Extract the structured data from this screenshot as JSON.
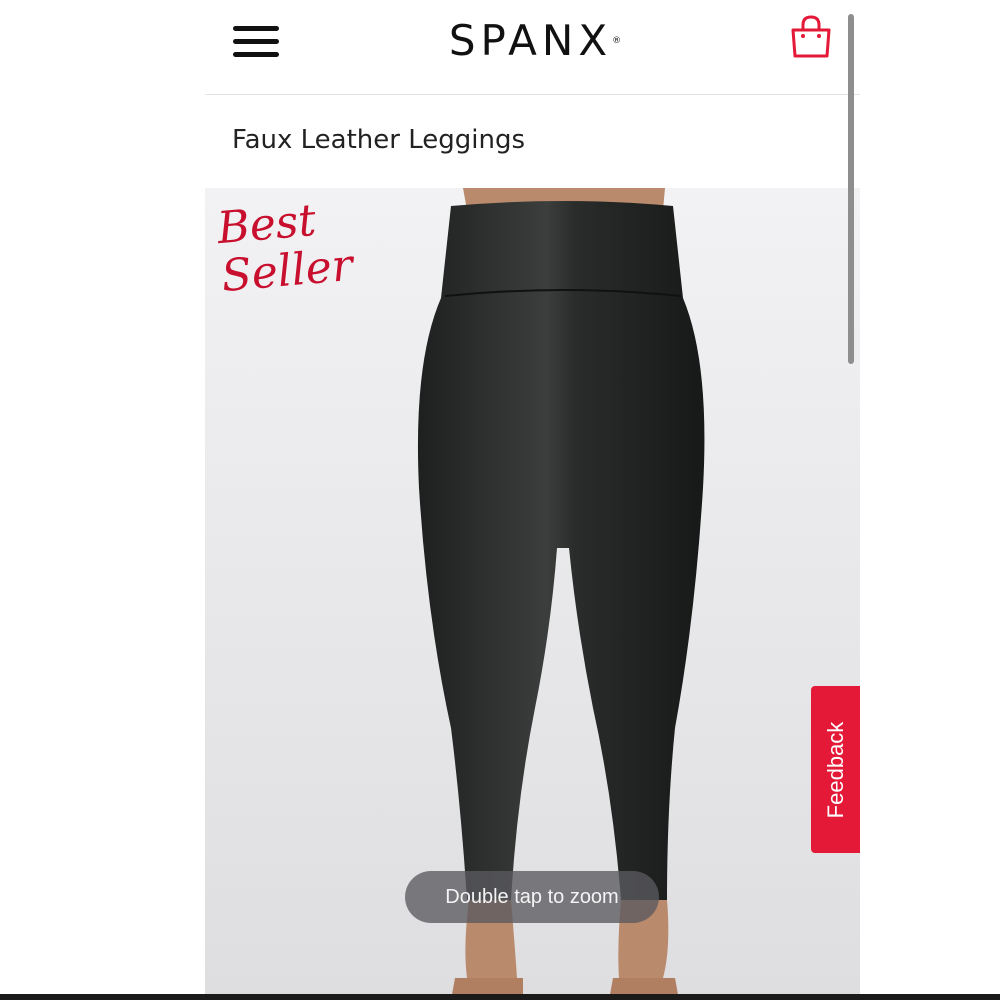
{
  "header": {
    "menu_icon": "hamburger-menu-icon",
    "logo_text": "SPANX",
    "logo_mark": "®",
    "bag_icon": "shopping-bag-icon"
  },
  "product": {
    "title": "Faux Leather Leggings",
    "badge_line1": "Best",
    "badge_line2": "Seller",
    "zoom_hint": "Double tap to zoom"
  },
  "feedback_tab": {
    "label": "Feedback"
  },
  "colors": {
    "brand_red": "#c8102e",
    "feedback_red": "#e31937",
    "image_background": "#e9e9eb",
    "leggings": "#2a2c2b"
  }
}
